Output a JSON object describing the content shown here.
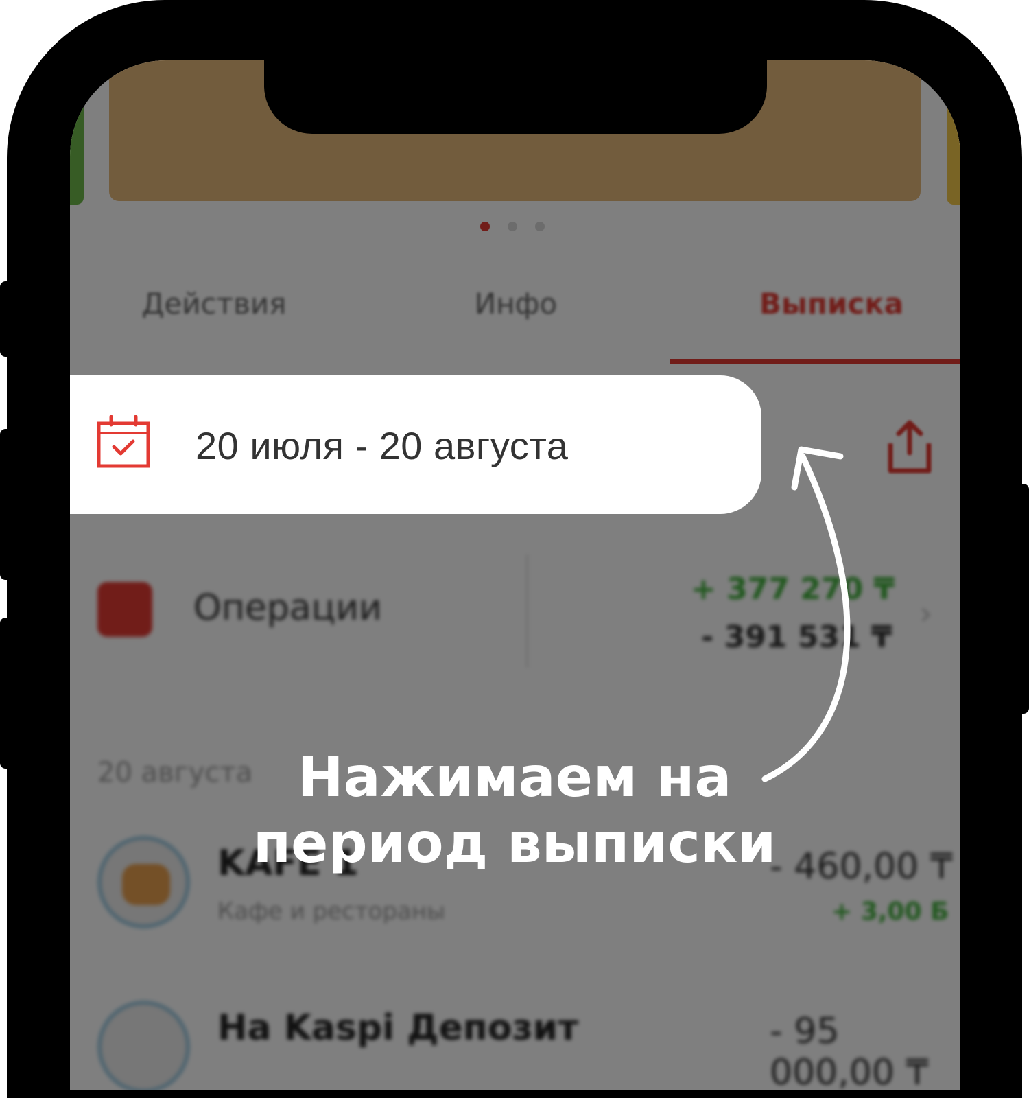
{
  "banner": {
    "dots_count": 3,
    "active_dot": 0
  },
  "tabs": [
    {
      "label": "Действия",
      "active": false
    },
    {
      "label": "Инфо",
      "active": false
    },
    {
      "label": "Выписка",
      "active": true
    }
  ],
  "period": {
    "label": "20 июля - 20 августа",
    "icon": "calendar-check-icon"
  },
  "operations": {
    "label": "Операции",
    "income": "+ 377 270 ₸",
    "expense": "- 391 531 ₸"
  },
  "transactions": {
    "date_header": "20 августа",
    "items": [
      {
        "name": "KAFE 1",
        "category": "Кафе и рестораны",
        "amount": "- 460,00 ₸",
        "bonus": "+ 3,00 Б"
      },
      {
        "name": "На Kaspi Депозит",
        "category": "",
        "amount": "- 95 000,00 ₸",
        "bonus": ""
      }
    ]
  },
  "caption": {
    "line1": "Нажимаем на",
    "line2": "период выписки"
  },
  "colors": {
    "accent": "#e33a33",
    "positive": "#3fae3a",
    "overlay": "rgba(0,0,0,0.5)"
  }
}
